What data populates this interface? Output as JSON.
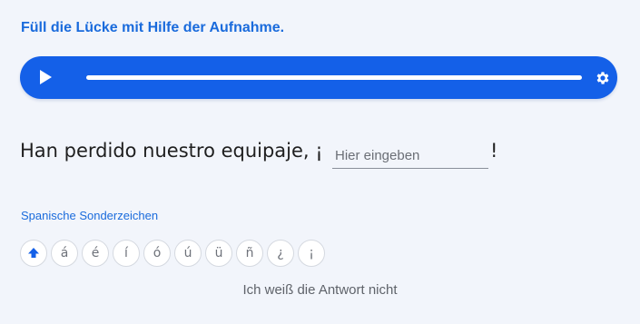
{
  "instruction": "Füll die Lücke mit Hilfe der Aufnahme.",
  "audio_player": {
    "play_icon": "play-icon",
    "settings_icon": "gear-icon",
    "progress": 0
  },
  "sentence": {
    "before": "Han perdido nuestro equipaje, ¡",
    "input_value": "",
    "input_placeholder": "Hier eingeben",
    "after": "!"
  },
  "special_chars": {
    "label": "Spanische Sonderzeichen",
    "shift_icon": "shift-arrow-icon",
    "chars": [
      "á",
      "é",
      "í",
      "ó",
      "ú",
      "ü",
      "ñ",
      "¿",
      "¡"
    ]
  },
  "dont_know_label": "Ich weiß die Antwort nicht",
  "colors": {
    "accent": "#1460e8",
    "link": "#1a6bdc",
    "background": "#f2f5fb"
  }
}
